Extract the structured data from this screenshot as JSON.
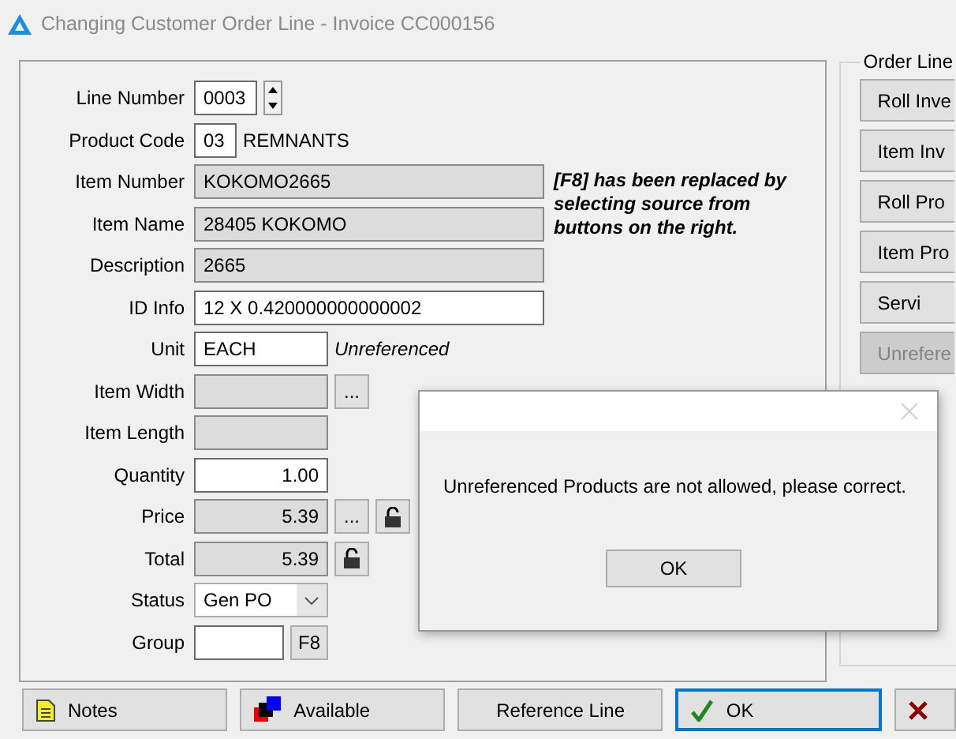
{
  "window": {
    "title": "Changing Customer Order Line - Invoice CC000156"
  },
  "form": {
    "fields": [
      {
        "label": "Line Number",
        "kind": "spinner",
        "value": "0003",
        "disabled": false
      },
      {
        "label": "Product Code",
        "kind": "code",
        "value": "03",
        "disabled": false,
        "suffix": "REMNANTS"
      },
      {
        "label": "Item Number",
        "kind": "wide",
        "value": "KOKOMO2665",
        "disabled": true
      },
      {
        "label": "Item Name",
        "kind": "wide",
        "value": "28405 KOKOMO",
        "disabled": true
      },
      {
        "label": "Description",
        "kind": "wide",
        "value": "2665",
        "disabled": true
      },
      {
        "label": "ID Info",
        "kind": "wide",
        "value": "12 X 0.420000000000002",
        "disabled": false
      },
      {
        "label": "Unit",
        "kind": "text",
        "value": "EACH",
        "disabled": false,
        "note": "Unreferenced"
      },
      {
        "label": "Item Width",
        "kind": "text",
        "disabled": true,
        "buttons": [
          {
            "kind": "text",
            "label": "..."
          }
        ]
      },
      {
        "label": "Item Length",
        "kind": "text",
        "disabled": true
      },
      {
        "label": "Quantity",
        "kind": "number",
        "value": "1.00",
        "disabled": false
      },
      {
        "label": "Price",
        "kind": "number",
        "value": "5.39",
        "disabled": true,
        "buttons": [
          {
            "kind": "text",
            "label": "..."
          },
          {
            "kind": "lock"
          }
        ]
      },
      {
        "label": "Total",
        "kind": "number",
        "value": "5.39",
        "disabled": true,
        "buttons": [
          {
            "kind": "lock"
          }
        ]
      },
      {
        "label": "Status",
        "kind": "select",
        "value": "Gen PO",
        "disabled": false
      },
      {
        "label": "Group",
        "kind": "short",
        "disabled": false,
        "buttons": [
          {
            "kind": "text",
            "label": "F8"
          }
        ]
      }
    ],
    "hint": "[F8] has been replaced by selecting source from buttons on the right."
  },
  "order_line": {
    "title": "Order Line",
    "buttons": [
      {
        "label": "Roll Inve",
        "disabled": false
      },
      {
        "label": "Item Inv",
        "disabled": false
      },
      {
        "label": "Roll Pro",
        "disabled": false
      },
      {
        "label": "Item Pro",
        "disabled": false
      },
      {
        "label": "Servi",
        "disabled": false
      },
      {
        "label": "Unrefere",
        "disabled": true
      }
    ]
  },
  "footer": [
    {
      "kind": "notes",
      "label": "Notes",
      "focused": false
    },
    {
      "kind": "available",
      "label": "Available",
      "focused": false
    },
    {
      "kind": "plain",
      "label": "Reference Line",
      "focused": false
    },
    {
      "kind": "ok",
      "label": "OK",
      "focused": true
    },
    {
      "kind": "cancel",
      "focused": false
    }
  ],
  "dialog": {
    "message": "Unreferenced Products are not allowed, please correct.",
    "button": "OK"
  }
}
